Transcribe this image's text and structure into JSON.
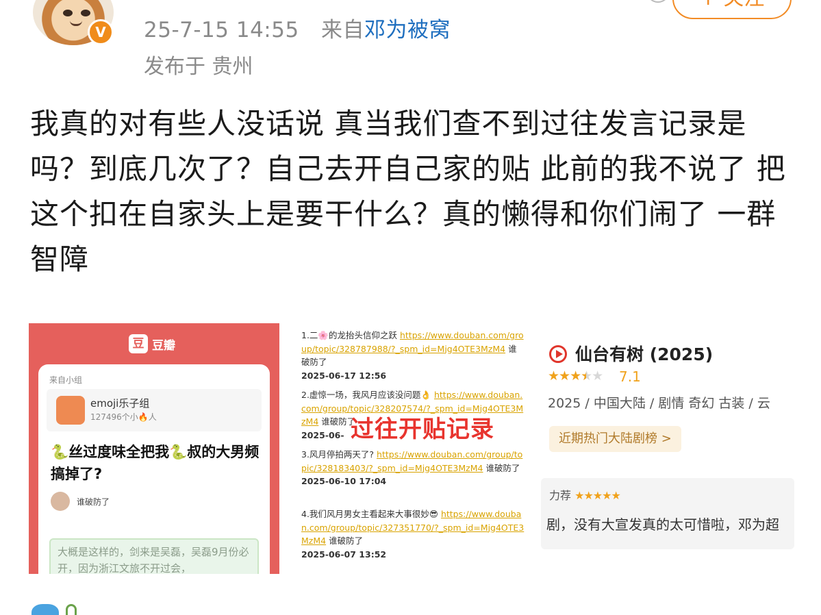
{
  "header": {
    "time": "25-7-15 14:55",
    "source_prefix": "来自",
    "source_name": "邓为被窝",
    "location": "发布于 贵州",
    "follow_label": "+ 关注",
    "verified_badge": "V"
  },
  "post": {
    "text": "我真的对有些人没话说 真当我们查不到过往发言记录是吗？到底几次了？自己去开自己家的贴 此前的我不说了 把这个扣在自家头上是要干什么？真的懒得和你们闹了 一群智障"
  },
  "images": {
    "douban_card": {
      "app_icon": "豆",
      "app_name": "豆瓣",
      "from_label": "来自小组",
      "group_name": "emoji乐子组",
      "group_count": "127496个小🔥人",
      "title": "🐍丝过度味全把我🐍叔的大男频搞掉了?",
      "user_name": "谁破防了",
      "quote": "大概是这样的，剑来是吴磊，吴磊9月份必开，因为浙江文旅不开过会，"
    },
    "record_list": {
      "stamp": "过往开贴记录",
      "entries": [
        {
          "title": "1.二🌸的龙抬头信仰之跃 ",
          "link": "https://www.douban.com/group/topic/328787988/?_spm_id=Mjg4OTE3MzM4",
          "user": " 谁破防了",
          "date": "2025-06-17 12:56"
        },
        {
          "title": "2.虚惊一场，我风月应该没问题👌 ",
          "link": "https://www.douban.com/group/topic/328207574/?_spm_id=Mjg4OTE3MzM4",
          "user": " 谁破防了",
          "date": "2025-06-"
        },
        {
          "title": "3.风月停拍两天了? ",
          "link": "https://www.douban.com/group/topic/328183403/?_spm_id=Mjg4OTE3MzM4",
          "user": " 谁破防了",
          "date": "2025-06-10 17:04"
        },
        {
          "title": "4.我们风月男女主看起来大事很妙😎 ",
          "link": "https://www.douban.com/group/topic/327351770/?_spm_id=Mjg4OTE3MzM4",
          "user": " 谁破防了",
          "date": "2025-06-07 13:52"
        }
      ]
    },
    "drama_card": {
      "title": "仙台有树 (2025)",
      "rating_stars": 3.5,
      "rating": "7.1",
      "info": "2025 / 中国大陆 / 剧情 奇幻 古装 / 云",
      "rank_link": "近期热门大陆剧榜 >",
      "review_label": "力荐",
      "review_text": "剧，没有大宣发真的太可惜啦，邓为超"
    }
  },
  "colors": {
    "link_blue": "#1f6fbf",
    "follow_orange": "#f28b24",
    "douban_red": "#e5605c",
    "link_gold": "#d9a300",
    "stamp_red": "#e8342e",
    "star_orange": "#f0a21c"
  }
}
